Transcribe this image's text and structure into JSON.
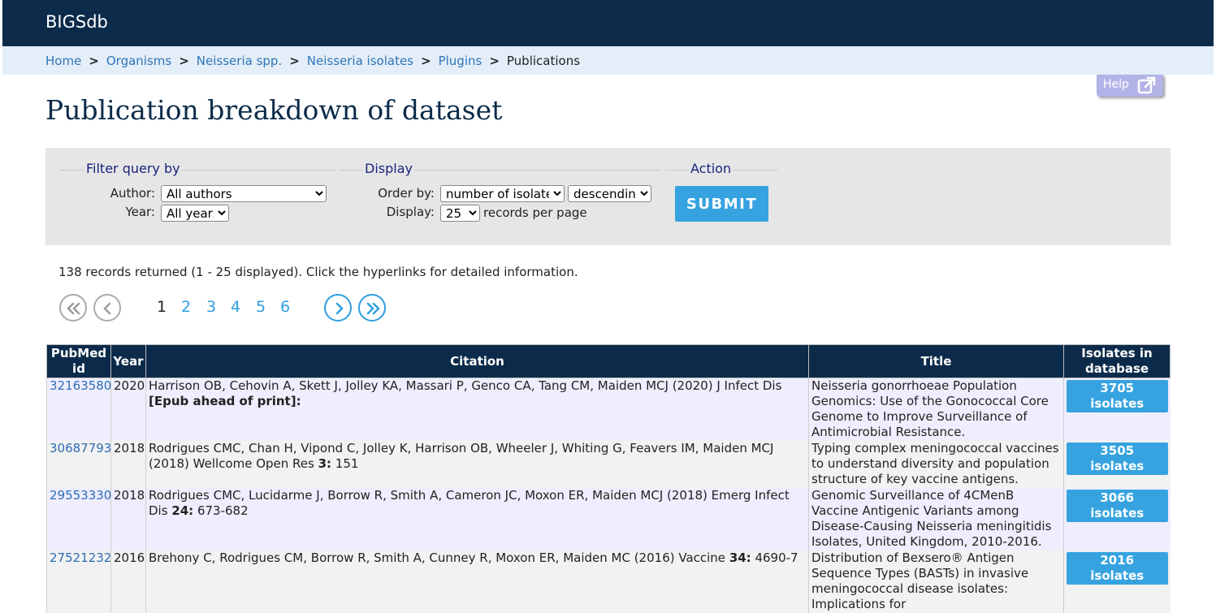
{
  "app": {
    "brand": "BIGSdb"
  },
  "breadcrumbs": [
    {
      "label": "Home"
    },
    {
      "label": "Organisms"
    },
    {
      "label": "Neisseria spp."
    },
    {
      "label": "Neisseria isolates"
    },
    {
      "label": "Plugins"
    }
  ],
  "breadcrumb_current": "Publications",
  "breadcrumb_sep": ">",
  "help": {
    "label": "Help",
    "icon": "external-link-icon"
  },
  "page_title": "Publication breakdown of dataset",
  "filter": {
    "legend": "Filter query by",
    "author_label": "Author:",
    "author_value": "All authors",
    "year_label": "Year:",
    "year_value": "All years"
  },
  "display": {
    "legend": "Display",
    "order_label": "Order by:",
    "order_value": "number of isolates",
    "direction_value": "descending",
    "display_label": "Display:",
    "per_page_value": "25",
    "per_page_suffix": "records per page"
  },
  "action": {
    "legend": "Action",
    "submit_label": "SUBMIT"
  },
  "summary": "138 records returned (1 - 25 displayed). Click the hyperlinks for detailed information.",
  "pagination": {
    "pages": [
      "1",
      "2",
      "3",
      "4",
      "5",
      "6"
    ],
    "current_page": "1",
    "icons": [
      "first-page-icon",
      "prev-page-icon",
      "next-page-icon",
      "last-page-icon"
    ]
  },
  "colors": {
    "header_bg": "#0c2b4a",
    "accent": "#36a3e0",
    "link": "#2e75b6"
  },
  "table": {
    "headers": {
      "pubmed": "PubMed id",
      "year": "Year",
      "citation": "Citation",
      "title": "Title",
      "isolates": "Isolates in database"
    },
    "rows": [
      {
        "pubmed": "32163580",
        "year": "2020",
        "citation_text": "Harrison OB, Cehovin A, Skett J, Jolley KA, Massari P, Genco CA, Tang CM, Maiden MCJ (2020) J Infect Dis ",
        "citation_bold": "[Epub ahead of print]:",
        "citation_end": "",
        "title": "Neisseria gonorrhoeae Population Genomics: Use of the Gonococcal Core Genome to Improve Surveillance of Antimicrobial Resistance.",
        "isolates": "3705 isolates"
      },
      {
        "pubmed": "30687793",
        "year": "2018",
        "citation_text": "Rodrigues CMC, Chan H, Vipond C, Jolley K, Harrison OB, Wheeler J, Whiting G, Feavers IM, Maiden MCJ (2018) Wellcome Open Res ",
        "citation_bold": "3:",
        "citation_end": " 151",
        "title": "Typing complex meningococcal vaccines to understand diversity and population structure of key vaccine antigens.",
        "isolates": "3505 isolates"
      },
      {
        "pubmed": "29553330",
        "year": "2018",
        "citation_text": "Rodrigues CMC, Lucidarme J, Borrow R, Smith A, Cameron JC, Moxon ER, Maiden MCJ (2018) Emerg Infect Dis ",
        "citation_bold": "24:",
        "citation_end": " 673-682",
        "title": "Genomic Surveillance of 4CMenB Vaccine Antigenic Variants among Disease-Causing Neisseria meningitidis Isolates, United Kingdom, 2010-2016.",
        "isolates": "3066 isolates"
      },
      {
        "pubmed": "27521232",
        "year": "2016",
        "citation_text": "Brehony C, Rodrigues CM, Borrow R, Smith A, Cunney R, Moxon ER, Maiden MC (2016) Vaccine ",
        "citation_bold": "34:",
        "citation_end": " 4690-7",
        "title": "Distribution of Bexsero® Antigen Sequence Types (BASTs) in invasive meningococcal disease isolates: Implications for",
        "isolates": "2016 isolates"
      }
    ]
  }
}
